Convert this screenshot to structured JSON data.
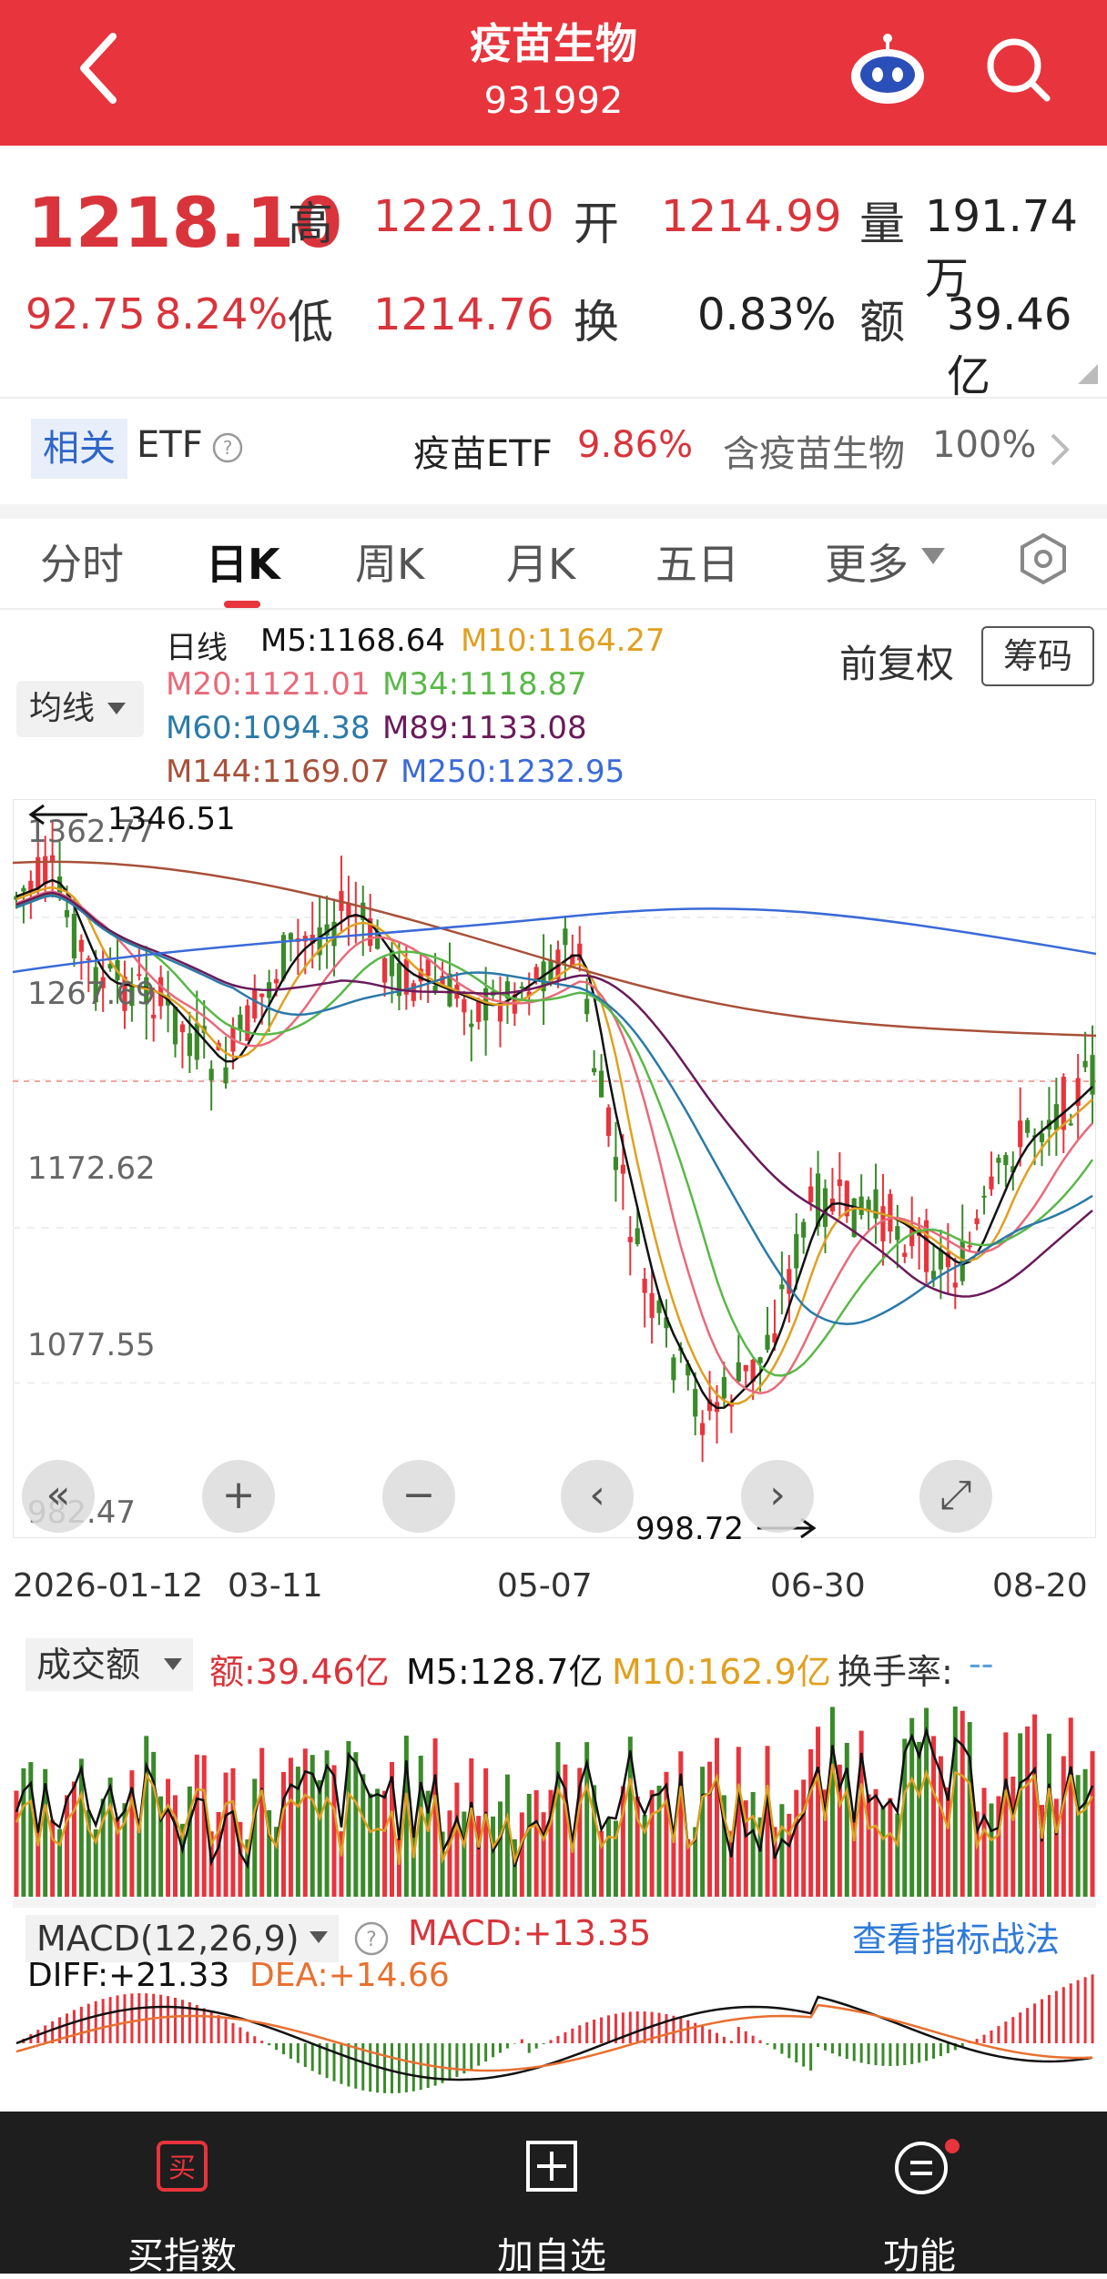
{
  "header": {
    "title": "疫苗生物",
    "code": "931992"
  },
  "quote": {
    "price": "1218.10",
    "change": "92.75",
    "change_pct": "8.24%",
    "high_label": "高",
    "high": "1222.10",
    "open_label": "开",
    "open": "1214.99",
    "vol_label": "量",
    "volume": "191.74万",
    "low_label": "低",
    "low": "1214.76",
    "turn_label": "换",
    "turnover": "0.83%",
    "amt_label": "额",
    "amount": "39.46亿"
  },
  "etf": {
    "tag": "相关",
    "word": "ETF",
    "name": "疫苗ETF",
    "pct": "9.86%",
    "holding": "含疫苗生物",
    "holding_pct": "100%"
  },
  "tabs": [
    "分时",
    "日K",
    "周K",
    "月K",
    "五日",
    "更多"
  ],
  "ma": {
    "type": "日线",
    "m5": "M5:1168.64",
    "m10": "M10:1164.27",
    "m20": "M20:1121.01",
    "m34": "M34:1118.87",
    "m60": "M60:1094.38",
    "m89": "M89:1133.08",
    "m144": "M144:1169.07",
    "m250": "M250:1232.95",
    "selector": "均线",
    "adjust": "前复权",
    "chips": "筹码"
  },
  "chart": {
    "y_labels": [
      "1362.77",
      "1267.69",
      "1172.62",
      "1077.55",
      "982.47"
    ],
    "max_label": "1346.51",
    "min_label": "998.72",
    "x_labels": [
      "2026-01-12",
      "03-11",
      "05-07",
      "06-30",
      "08-20"
    ]
  },
  "volume": {
    "selector": "成交额",
    "amt": "额:39.46亿",
    "m5": "M5:128.7亿",
    "m10": "M10:162.9亿",
    "turn": "换手率:",
    "turn_val": "--"
  },
  "macd": {
    "selector": "MACD(12,26,9)",
    "macd": "MACD:+13.35",
    "link": "查看指标战法",
    "diff": "DIFF:+21.33",
    "dea": "DEA:+14.66"
  },
  "bottom": {
    "buy": "买指数",
    "buy_icon": "买",
    "add": "加自选",
    "func": "功能"
  },
  "colors": {
    "up": "#e8343c",
    "down": "#3a8a2a",
    "brand": "#e8343c",
    "blue": "#2f66c8"
  }
}
